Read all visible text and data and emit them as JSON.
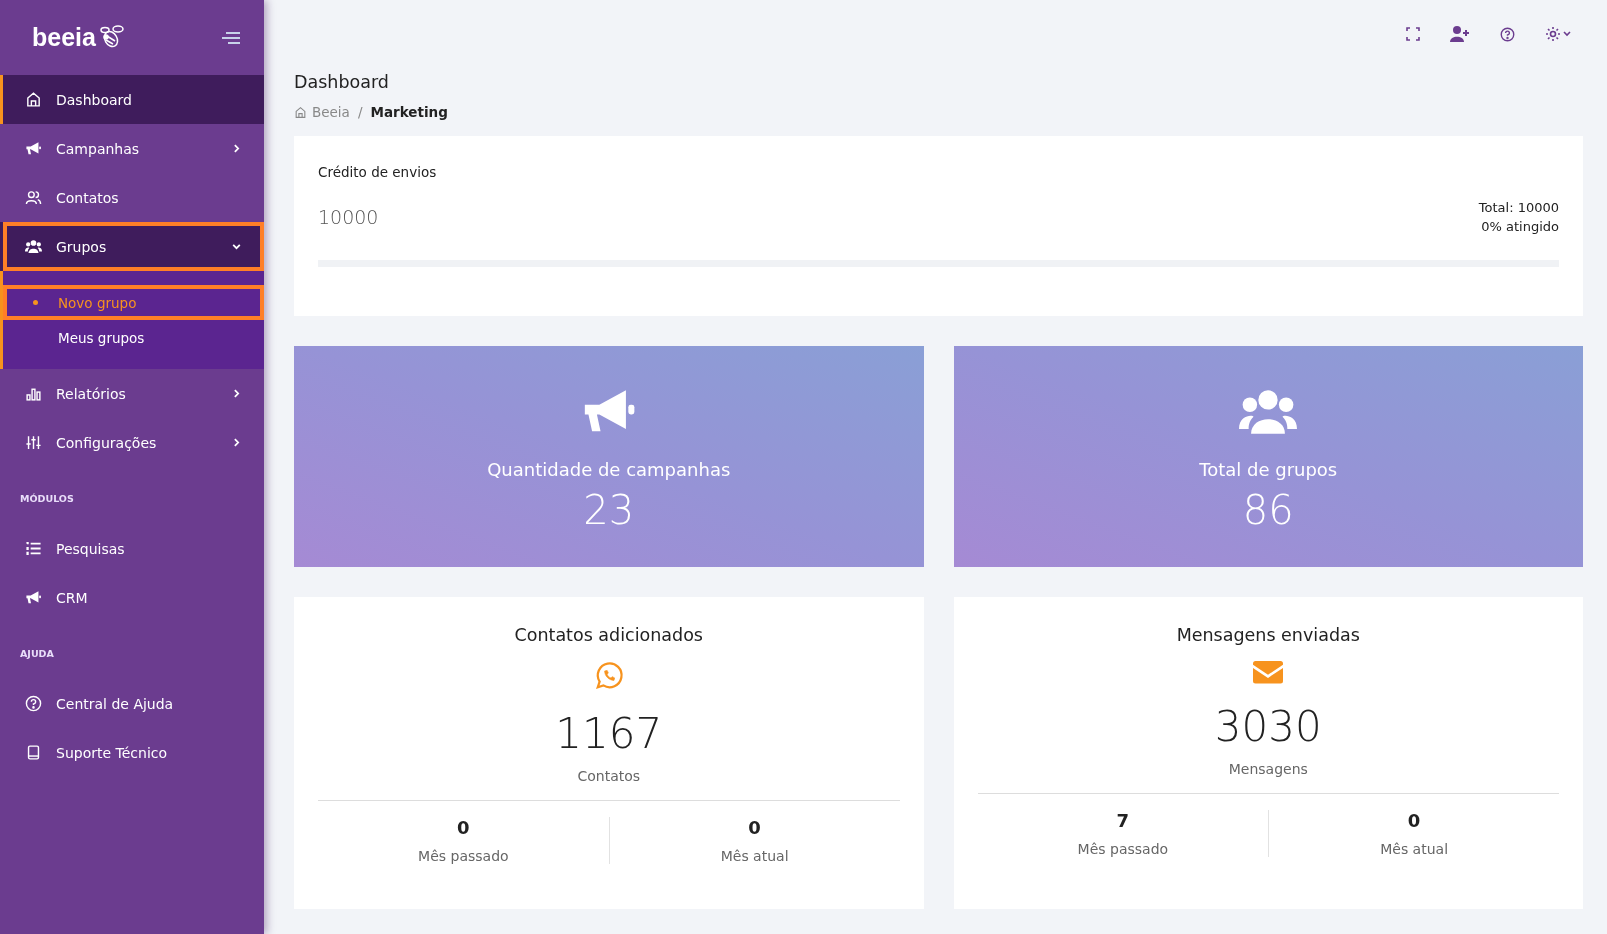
{
  "sidebar": {
    "logo": "beeia",
    "items": [
      {
        "kind": "link",
        "label": "Dashboard",
        "selected": true,
        "highlighted": false
      },
      {
        "kind": "menu",
        "label": "Campanhas",
        "selected": false,
        "highlighted": false,
        "expanded": false
      },
      {
        "kind": "link",
        "label": "Contatos",
        "selected": false,
        "highlighted": false
      },
      {
        "kind": "menu",
        "label": "Grupos",
        "selected": false,
        "highlighted": true,
        "expanded": true,
        "children": [
          {
            "label": "Novo grupo",
            "selected": true,
            "highlighted": true
          },
          {
            "label": "Meus grupos",
            "selected": false,
            "highlighted": false
          }
        ]
      },
      {
        "kind": "menu",
        "label": "Relatórios",
        "selected": false,
        "highlighted": false,
        "expanded": false
      },
      {
        "kind": "menu",
        "label": "Configurações",
        "selected": false,
        "highlighted": false,
        "expanded": false
      },
      {
        "kind": "heading",
        "label": "MÓDULOS"
      },
      {
        "kind": "link",
        "label": "Pesquisas",
        "selected": false,
        "highlighted": false
      },
      {
        "kind": "link",
        "label": "CRM",
        "selected": false,
        "highlighted": false
      },
      {
        "kind": "heading",
        "label": "AJUDA"
      },
      {
        "kind": "link",
        "label": "Central de Ajuda",
        "selected": false,
        "highlighted": false
      },
      {
        "kind": "link",
        "label": "Suporte Técnico",
        "selected": false,
        "highlighted": false
      }
    ]
  },
  "page": {
    "title": "Dashboard",
    "breadcrumb": [
      "Beeia",
      "/",
      "Marketing"
    ]
  },
  "credit": {
    "title": "Crédito de envios",
    "value": "10000",
    "total": "Total: 10000",
    "reached": "0% atingido",
    "level": 0
  },
  "stat_cards": [
    {
      "label": "Quantidade de campanhas",
      "value": "23"
    },
    {
      "label": "Total de grupos",
      "value": "86"
    }
  ],
  "summary_cards": [
    {
      "title": "Contatos adicionados",
      "value": "1167",
      "unit": "Contatos",
      "last_month": "0",
      "last_month_label": "Mês passado",
      "this_month": "0",
      "this_month_label": "Mês atual"
    },
    {
      "title": "Mensagens enviadas",
      "value": "3030",
      "unit": "Mensagens",
      "last_month": "7",
      "last_month_label": "Mês passado",
      "this_month": "0",
      "this_month_label": "Mês atual"
    }
  ]
}
